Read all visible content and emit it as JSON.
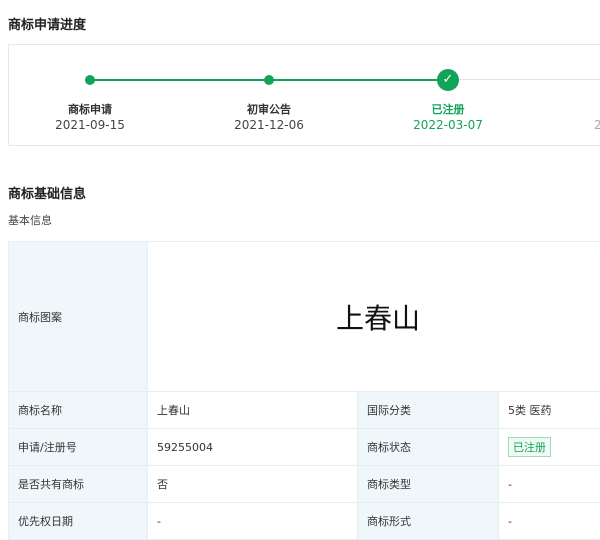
{
  "progress": {
    "title": "商标申请进度",
    "steps": [
      {
        "label": "商标申请",
        "date": "2021-09-15"
      },
      {
        "label": "初审公告",
        "date": "2021-12-06"
      },
      {
        "label": "已注册",
        "date": "2022-03-07"
      },
      {
        "label": "",
        "date": "2"
      }
    ]
  },
  "info": {
    "title": "商标基础信息",
    "subtitle": "基本信息",
    "pattern_label": "商标图案",
    "pattern_text": "上春山",
    "rows": [
      {
        "k1": "商标名称",
        "v1": "上春山",
        "k2": "国际分类",
        "v2": "5类 医药"
      },
      {
        "k1": "申请/注册号",
        "v1": "59255004",
        "k2": "商标状态",
        "v2": "已注册"
      },
      {
        "k1": "是否共有商标",
        "v1": "否",
        "k2": "商标类型",
        "v2": "-"
      },
      {
        "k1": "优先权日期",
        "v1": "-",
        "k2": "商标形式",
        "v2": "-"
      }
    ]
  },
  "colors": {
    "accent": "#12a35b"
  }
}
